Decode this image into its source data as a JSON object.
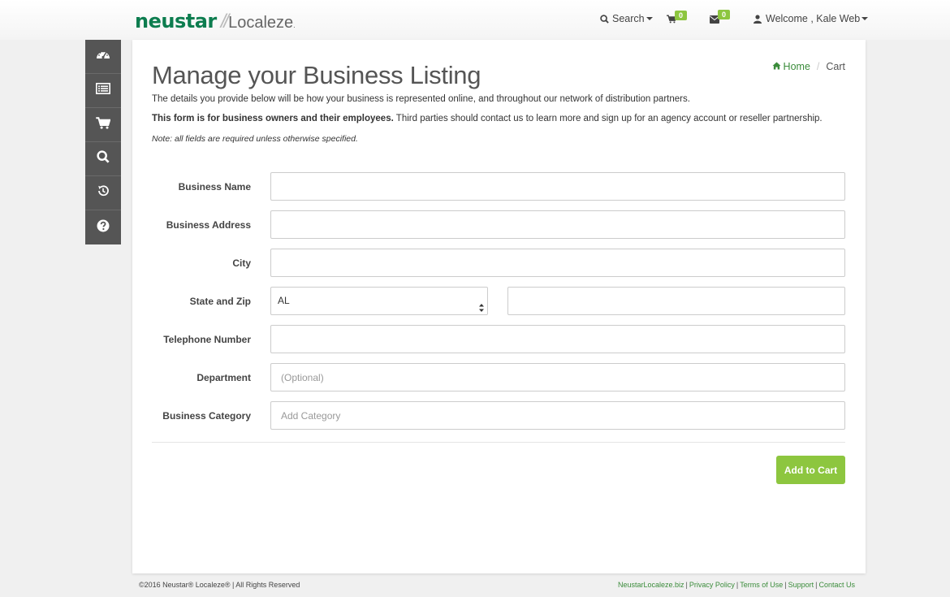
{
  "brand": {
    "neustar": "neustar",
    "slash": "//",
    "localeze": "Localeze",
    "reg": "."
  },
  "nav": {
    "search_label": "Search",
    "cart_count": "0",
    "messages_count": "0",
    "welcome_label": "Welcome , Kale Web"
  },
  "sidebar": {
    "items": [
      {
        "icon": "dashboard-icon"
      },
      {
        "icon": "list-icon"
      },
      {
        "icon": "cart-icon"
      },
      {
        "icon": "search-icon"
      },
      {
        "icon": "history-icon"
      },
      {
        "icon": "help-icon"
      }
    ]
  },
  "page": {
    "title": "Manage your Business Listing",
    "breadcrumb": {
      "home": "Home",
      "current": "Cart"
    },
    "desc1": "The details you provide below will be how your business is represented online, and throughout our network of distribution partners.",
    "desc2_bold": "This form is for business owners and their employees.",
    "desc2_rest": " Third parties should contact us to learn more and sign up for an agency account or reseller partnership.",
    "note": "Note: all fields are required unless otherwise specified."
  },
  "form": {
    "business_name_label": "Business Name",
    "business_address_label": "Business Address",
    "city_label": "City",
    "state_zip_label": "State and Zip",
    "state_value": "AL",
    "telephone_label": "Telephone Number",
    "department_label": "Department",
    "department_placeholder": "(Optional)",
    "category_label": "Business Category",
    "category_placeholder": "Add Category",
    "submit_label": "Add to Cart"
  },
  "footer": {
    "copyright": "©2016 Neustar® Localeze® | All Rights Reserved",
    "links": {
      "site": "NeustarLocaleze.biz",
      "privacy": "Privacy Policy",
      "terms": "Terms of Use",
      "support": "Support",
      "contact": "Contact Us"
    }
  },
  "colors": {
    "brand_green": "#0d7d4f",
    "accent_green": "#8dc63f",
    "link_green": "#3b8c3b",
    "sidebar_bg": "#555555"
  }
}
